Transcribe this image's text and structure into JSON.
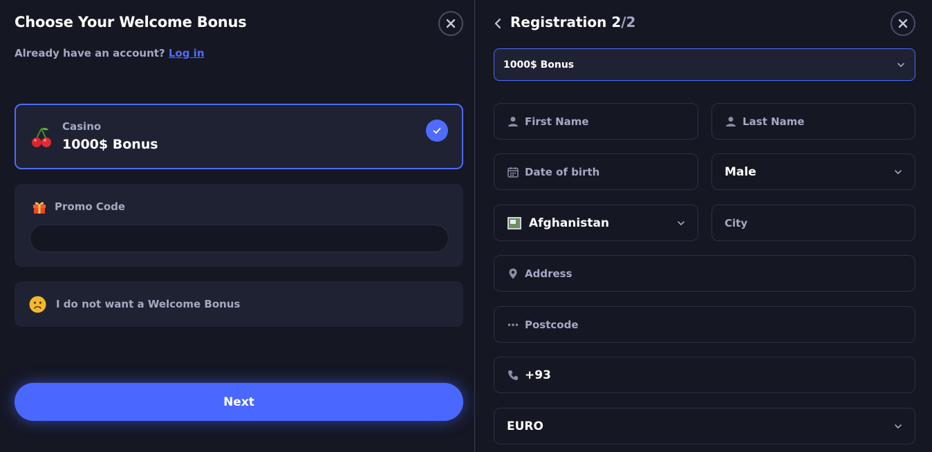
{
  "left": {
    "title": "Choose Your Welcome Bonus",
    "account_prompt": "Already have an account?",
    "login_link": "Log in",
    "bonus_card": {
      "category": "Casino",
      "amount": "1000$ Bonus",
      "selected": true
    },
    "promo": {
      "label": "Promo Code",
      "value": "",
      "placeholder": ""
    },
    "no_bonus_label": "I do not want a Welcome Bonus",
    "next_label": "Next"
  },
  "right": {
    "title": "Registration 2",
    "title_suffix": "/2",
    "bonus_select": "1000$ Bonus",
    "fields": {
      "first_name": "First Name",
      "last_name": "Last Name",
      "dob": "Date of birth",
      "gender": "Male",
      "country": "Afghanistan",
      "city": "City",
      "address": "Address",
      "postcode": "Postcode",
      "phone": "+93",
      "currency": "EURO"
    }
  },
  "colors": {
    "background": "#151723",
    "accent": "#4f6cff",
    "muted_text": "#a5a9c2",
    "card": "#1f2232"
  },
  "icons": [
    "close-icon",
    "cherry-icon",
    "check-icon",
    "gift-icon",
    "sad-face-icon",
    "back-arrow-icon",
    "chevron-down-icon",
    "user-icon",
    "calendar-icon",
    "flag-icon",
    "location-pin-icon",
    "dots-icon",
    "phone-icon"
  ]
}
